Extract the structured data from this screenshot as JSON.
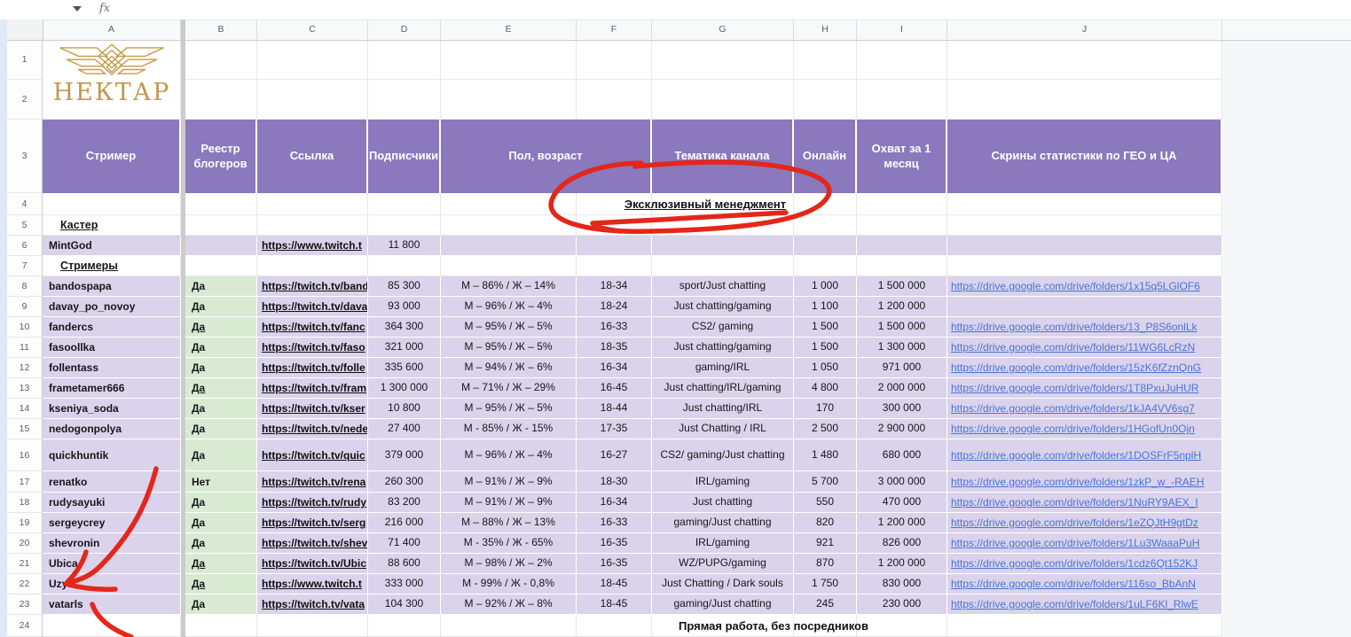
{
  "formula_bar": {
    "fx": "fx"
  },
  "sheet": {
    "column_letters": [
      "A",
      "B",
      "C",
      "D",
      "E",
      "F",
      "G",
      "H",
      "I",
      "J"
    ],
    "row_count": 24
  },
  "logo": {
    "brand": "НЕКТАР"
  },
  "banners": {
    "exclusive": "Эксклюзивный менеджмент",
    "direct": "Прямая работа, без посредников"
  },
  "sections": {
    "caster": "Кастер",
    "streamers": "Стримеры"
  },
  "table": {
    "headers": [
      {
        "c": "A",
        "label": "Стример"
      },
      {
        "c": "B",
        "label": "Реестр блогеров"
      },
      {
        "c": "C",
        "label": "Ссылка"
      },
      {
        "c": "D",
        "label": "Подписчики"
      },
      {
        "c": "EF",
        "label": "Пол, возраст"
      },
      {
        "c": "G",
        "label": "Тематика канала"
      },
      {
        "c": "H",
        "label": "Онлайн"
      },
      {
        "c": "I",
        "label": "Охват за 1 месяц"
      },
      {
        "c": "J",
        "label": "Скрины статистики по ГЕО и ЦА"
      }
    ],
    "caster_row": {
      "row": 6,
      "name": "MintGod",
      "link": "https://www.twitch.t",
      "subscribers": "11 800"
    },
    "rows": [
      {
        "row": 8,
        "name": "bandospapa",
        "registry": "Да",
        "registry_underlined": false,
        "link": "https://twitch.tv/band",
        "subscribers": "85 300",
        "gender_split": "М – 86% / Ж – 14%",
        "age": "18-34",
        "theme": "sport/Just chatting",
        "online": "1 000",
        "monthly_reach": "1 500 000",
        "stats_link": "https://drive.google.com/drive/folders/1x15q5LGlOF6"
      },
      {
        "row": 9,
        "name": "davay_po_novoy",
        "registry": "Да",
        "registry_underlined": false,
        "link": "https://twitch.tv/dava",
        "subscribers": "93 000",
        "gender_split": "М – 96% / Ж – 4%",
        "age": "18-24",
        "theme": "Just chatting/gaming",
        "online": "1 100",
        "monthly_reach": "1 200 000",
        "stats_link": ""
      },
      {
        "row": 10,
        "name": "fandercs",
        "registry": "Да",
        "registry_underlined": true,
        "link": "https://twitch.tv/fanc",
        "subscribers": "364 300",
        "gender_split": "М – 95% / Ж – 5%",
        "age": "16-33",
        "theme": "CS2/ gaming",
        "online": "1 500",
        "monthly_reach": "1 500 000",
        "stats_link": "https://drive.google.com/drive/folders/13_P8S6onlLk"
      },
      {
        "row": 11,
        "name": "fasoollka",
        "registry": "Да",
        "registry_underlined": false,
        "link": "https://twitch.tv/faso",
        "subscribers": "321 000",
        "gender_split": "М – 95% / Ж – 5%",
        "age": "18-35",
        "theme": "Just chatting/gaming",
        "online": "1 500",
        "monthly_reach": "1 300 000",
        "stats_link": "https://drive.google.com/drive/folders/11WG6LcRzN"
      },
      {
        "row": 12,
        "name": "follentass",
        "registry": "Да",
        "registry_underlined": false,
        "link": "https://twitch.tv/folle",
        "subscribers": "335 600",
        "gender_split": "М – 94% / Ж – 6%",
        "age": "16-34",
        "theme": "gaming/IRL",
        "online": "1 050",
        "monthly_reach": "971 000",
        "stats_link": "https://drive.google.com/drive/folders/15zK6fZznQnG"
      },
      {
        "row": 13,
        "name": "frametamer666",
        "registry": "Да",
        "registry_underlined": true,
        "link": "https://twitch.tv/fram",
        "subscribers": "1 300 000",
        "gender_split": "М – 71% / Ж – 29%",
        "age": "16-45",
        "theme": "Just chatting/IRL/gaming",
        "online": "4 800",
        "monthly_reach": "2 000 000",
        "stats_link": "https://drive.google.com/drive/folders/1T8PxuJuHUR"
      },
      {
        "row": 14,
        "name": "kseniya_soda",
        "registry": "Да",
        "registry_underlined": false,
        "link": "https://twitch.tv/kser",
        "subscribers": "10 800",
        "gender_split": "М – 95% / Ж – 5%",
        "age": "18-44",
        "theme": "Just chatting/IRL",
        "online": "170",
        "monthly_reach": "300 000",
        "stats_link": "https://drive.google.com/drive/folders/1kJA4VV6sg7"
      },
      {
        "row": 15,
        "name": "nedogonpolya",
        "registry": "Да",
        "registry_underlined": false,
        "link": "https://twitch.tv/nede",
        "subscribers": "27 400",
        "gender_split": "М - 85% / Ж - 15%",
        "age": "17-35",
        "theme": "Just Chatting / IRL",
        "online": "2 500",
        "monthly_reach": "2 900 000",
        "stats_link": "https://drive.google.com/drive/folders/1HGofUn0Ojn"
      },
      {
        "row": 16,
        "name": "quickhuntik",
        "registry": "Да",
        "registry_underlined": false,
        "link": "https://twitch.tv/quic",
        "subscribers": "379 000",
        "gender_split": "М – 96% / Ж – 4%",
        "age": "16-27",
        "theme": "CS2/ gaming/Just chatting",
        "online": "1 480",
        "monthly_reach": "680 000",
        "stats_link": "https://drive.google.com/drive/folders/1DOSFrF5nplH"
      },
      {
        "row": 17,
        "name": "renatko",
        "registry": "Нет",
        "registry_underlined": false,
        "link": "https://twitch.tv/rena",
        "subscribers": "260 300",
        "gender_split": "М – 91% / Ж – 9%",
        "age": "18-30",
        "theme": "IRL/gaming",
        "online": "5 700",
        "monthly_reach": "3 000 000",
        "stats_link": "https://drive.google.com/drive/folders/1zkP_w_-RAEH"
      },
      {
        "row": 18,
        "name": "rudysayuki",
        "registry": "Да",
        "registry_underlined": false,
        "link": "https://twitch.tv/rudy",
        "subscribers": "83 200",
        "gender_split": "М – 91% / Ж – 9%",
        "age": "16-34",
        "theme": "Just chatting",
        "online": "550",
        "monthly_reach": "470 000",
        "stats_link": "https://drive.google.com/drive/folders/1NuRY9AEX_I"
      },
      {
        "row": 19,
        "name": "sergeycrey",
        "registry": "Да",
        "registry_underlined": false,
        "link": "https://twitch.tv/serg",
        "subscribers": "216 000",
        "gender_split": "М – 88% / Ж – 13%",
        "age": "16-33",
        "theme": "gaming/Just chatting",
        "online": "820",
        "monthly_reach": "1 200 000",
        "stats_link": "https://drive.google.com/drive/folders/1eZQJtH9gtDz"
      },
      {
        "row": 20,
        "name": "shevronin",
        "registry": "Да",
        "registry_underlined": false,
        "link": "https://twitch.tv/shev",
        "subscribers": "71 400",
        "gender_split": "М - 35% / Ж - 65%",
        "age": "16-35",
        "theme": "IRL/gaming",
        "online": "921",
        "monthly_reach": "826 000",
        "stats_link": "https://drive.google.com/drive/folders/1Lu3WaaaPuH"
      },
      {
        "row": 21,
        "name": "Ubica",
        "registry": "Да",
        "registry_underlined": true,
        "link": "https://twitch.tv/Ubic",
        "subscribers": "88 600",
        "gender_split": "М – 98% / Ж – 2%",
        "age": "16-35",
        "theme": "WZ/PUPG/gaming",
        "online": "870",
        "monthly_reach": "1 200 000",
        "stats_link": "https://drive.google.com/drive/folders/1cdz6Qt152KJ"
      },
      {
        "row": 22,
        "name": "Uzya",
        "registry": "Да",
        "registry_underlined": true,
        "link": "https://www.twitch.t",
        "subscribers": "333 000",
        "gender_split": "М - 99% / Ж - 0,8%",
        "age": "18-45",
        "theme": "Just Chatting / Dark souls",
        "online": "1 750",
        "monthly_reach": "830 000",
        "stats_link": "https://drive.google.com/drive/folders/116so_BbAnN"
      },
      {
        "row": 23,
        "name": "vatarls",
        "registry": "Да",
        "registry_underlined": false,
        "link": "https://twitch.tv/vata",
        "subscribers": "104 300",
        "gender_split": "М – 92% / Ж – 8%",
        "age": "18-45",
        "theme": "gaming/Just chatting",
        "online": "245",
        "monthly_reach": "230 000",
        "stats_link": "https://drive.google.com/drive/folders/1uLF6Kl_RlwE"
      }
    ]
  },
  "annotations": {
    "circle_target": "Эксклюзивный менеджмент",
    "arrow_target": "Uzya",
    "red": "#E3271A"
  },
  "colors": {
    "header_purple": "#8A79BC",
    "row_lavender": "#DAD3EB",
    "yes_green": "#D9EAD3",
    "link_blue": "#4A74D8",
    "brand_gold": "#C49649"
  }
}
